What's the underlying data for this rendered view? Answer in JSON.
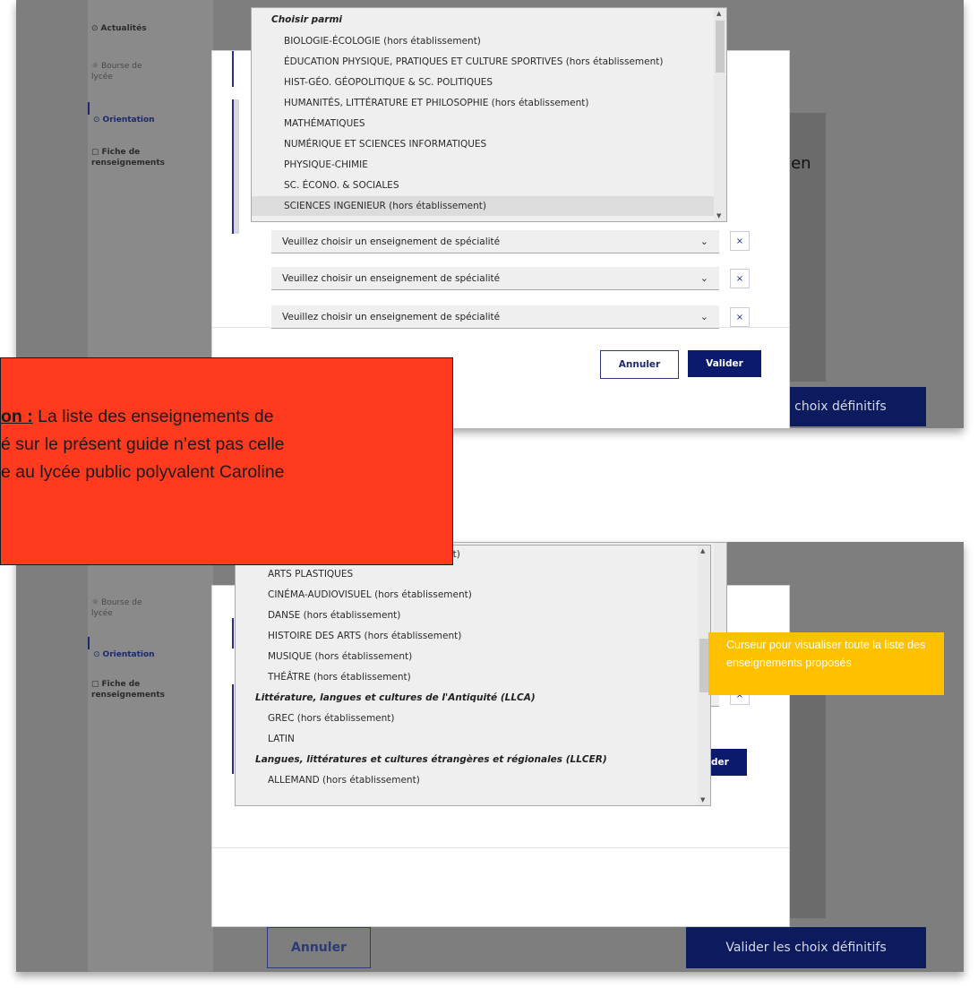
{
  "sidebar": {
    "actualites": "Actualités",
    "bourse": "Bourse de\nlycée",
    "orientation": "Orientation",
    "fiche": "Fiche de\nrenseignements"
  },
  "background": {
    "fragment_text": "is en",
    "valider_definitifs": "Valider les choix définitifs",
    "annuler": "Annuler"
  },
  "dropdown1": {
    "group": "Choisir parmi",
    "options": [
      "BIOLOGIE-ÉCOLOGIE (hors établissement)",
      "ÉDUCATION PHYSIQUE, PRATIQUES ET CULTURE SPORTIVES (hors établissement)",
      "HIST-GÉO. GÉOPOLITIQUE & SC. POLITIQUES",
      "HUMANITÉS, LITTÉRATURE ET PHILOSOPHIE (hors établissement)",
      "MATHÉMATIQUES",
      "NUMÉRIQUE ET SCIENCES INFORMATIQUES",
      "PHYSIQUE-CHIMIE",
      "SC. ÉCONO. & SOCIALES",
      "SCIENCES INGENIEUR (hors établissement)"
    ]
  },
  "dropdown2": {
    "top_partial": "nt)",
    "items": [
      {
        "text": "ARTS PLASTIQUES",
        "group": false
      },
      {
        "text": "CINÉMA-AUDIOVISUEL (hors établissement)",
        "group": false
      },
      {
        "text": "DANSE (hors établissement)",
        "group": false
      },
      {
        "text": "HISTOIRE DES ARTS (hors établissement)",
        "group": false
      },
      {
        "text": "MUSIQUE (hors établissement)",
        "group": false
      },
      {
        "text": "THÉÂTRE (hors établissement)",
        "group": false
      },
      {
        "text": "Littérature, langues et cultures de l'Antiquité (LLCA)",
        "group": true
      },
      {
        "text": "GREC (hors établissement)",
        "group": false
      },
      {
        "text": "LATIN",
        "group": false
      },
      {
        "text": "Langues, littératures et cultures étrangères et régionales (LLCER)",
        "group": true
      },
      {
        "text": "ALLEMAND (hors établissement)",
        "group": false
      }
    ]
  },
  "select_placeholder": "Veuillez choisir un enseignement de spécialité",
  "remove_label": "×",
  "modal_buttons": {
    "annuler": "Annuler",
    "valider": "Valider"
  },
  "notes": {
    "red_label": "on :",
    "red_line1": " La liste des enseignements de",
    "red_line2": "é sur le présent guide n’est pas celle",
    "red_line3": "e au lycée public polyvalent Caroline",
    "yellow": "Curseur pour visualiser toute la liste des enseignements proposés"
  },
  "colors": {
    "accent": "#0c1a6e",
    "note_red": "#ff3a1f",
    "note_yellow": "#ffc000"
  }
}
